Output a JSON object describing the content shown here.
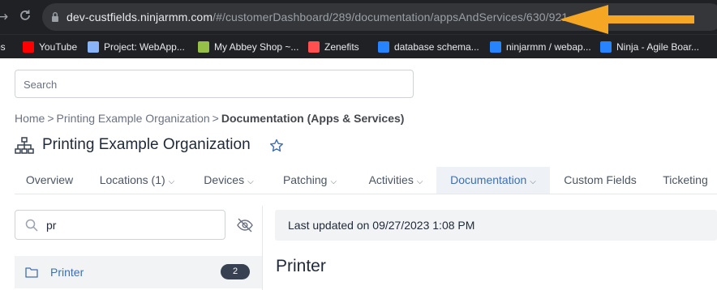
{
  "browser": {
    "url_host": "dev-custfields.ninjarmm.com",
    "url_path": "/#/customerDashboard/289/documentation/appsAndServices/630/921",
    "bookmarks": [
      {
        "label": "ps",
        "icon": "apps-icon",
        "color": "#4285f4"
      },
      {
        "label": "YouTube",
        "icon": "youtube-icon",
        "color": "#ff0000"
      },
      {
        "label": "Project: WebApp...",
        "icon": "project-icon",
        "color": "#8ab4f8"
      },
      {
        "label": "My Abbey Shop ~...",
        "icon": "shopify-icon",
        "color": "#95bf47"
      },
      {
        "label": "Zenefits",
        "icon": "zenefits-icon",
        "color": "#ff4f4f"
      },
      {
        "label": "database schema...",
        "icon": "confluence-icon",
        "color": "#2684ff"
      },
      {
        "label": "ninjarmm / webap...",
        "icon": "bitbucket-icon",
        "color": "#2684ff"
      },
      {
        "label": "Ninja - Agile Boar...",
        "icon": "jira-icon",
        "color": "#2684ff"
      }
    ]
  },
  "search": {
    "placeholder": "Search"
  },
  "breadcrumb": {
    "home": "Home",
    "org": "Printing Example Organization",
    "current": "Documentation (Apps & Services)",
    "separator": ">"
  },
  "page": {
    "title": "Printing Example Organization"
  },
  "tabs": [
    {
      "label": "Overview",
      "dropdown": false
    },
    {
      "label": "Locations (1)",
      "dropdown": true
    },
    {
      "label": "Devices",
      "dropdown": true
    },
    {
      "label": "Patching",
      "dropdown": true
    },
    {
      "label": "Activities",
      "dropdown": true
    },
    {
      "label": "Documentation",
      "dropdown": true,
      "active": true
    },
    {
      "label": "Custom Fields",
      "dropdown": false
    },
    {
      "label": "Ticketing",
      "dropdown": false
    }
  ],
  "sidebar": {
    "search_value": "pr",
    "items": [
      {
        "label": "Printer",
        "count": "2"
      }
    ]
  },
  "main": {
    "last_updated": "Last updated on 09/27/2023 1:08 PM",
    "doc_title": "Printer"
  },
  "colors": {
    "accent": "#3f6fb0",
    "annotation_arrow": "#f5a623",
    "badge": "#374151"
  }
}
